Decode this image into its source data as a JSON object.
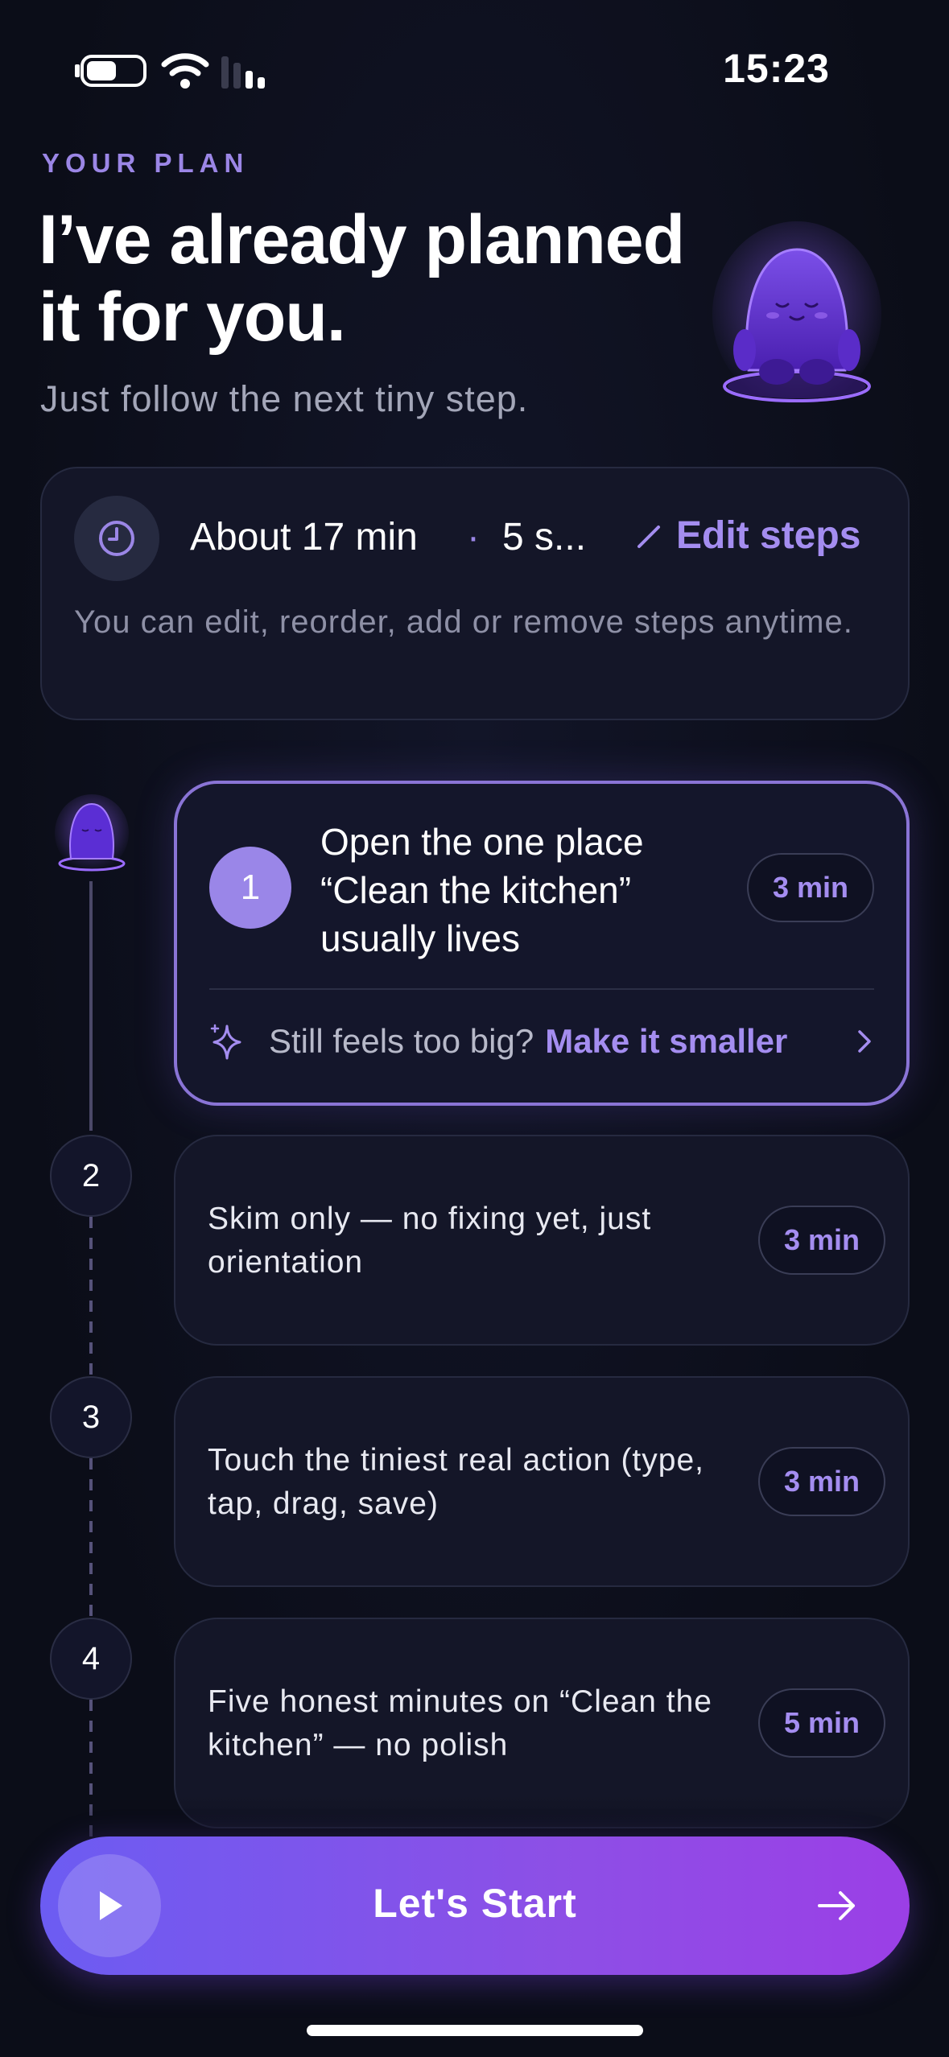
{
  "status_bar": {
    "time": "15:23"
  },
  "header": {
    "eyebrow": "YOUR PLAN",
    "title": "I’ve already planned it for you.",
    "subtitle": "Just follow the next tiny step."
  },
  "summary": {
    "duration": "About 17 min",
    "separator": "·",
    "steps": "5 s...",
    "edit_label": "Edit steps",
    "note": "You can edit, reorder, add or remove steps anytime."
  },
  "steps": [
    {
      "number": "1",
      "text": "Open the one place “Clean the kitchen” usually lives",
      "duration": "3 min"
    },
    {
      "number": "2",
      "text": "Skim only — no fixing yet, just orientation",
      "duration": "3 min"
    },
    {
      "number": "3",
      "text": "Touch the tiniest real action (type, tap, drag, save)",
      "duration": "3 min"
    },
    {
      "number": "4",
      "text": "Five honest minutes on “Clean the kitchen” — no polish",
      "duration": "5 min"
    }
  ],
  "make_smaller": {
    "question": "Still feels too big?",
    "link": "Make it smaller"
  },
  "cta": {
    "label": "Let's Start"
  },
  "icons": {
    "battery": "battery-icon",
    "wifi": "wifi-icon",
    "signal": "signal-icon",
    "clock": "clock-icon",
    "pencil": "pencil-icon",
    "sparkle": "sparkle-icon",
    "chevron": "chevron-right-icon",
    "play": "play-icon",
    "arrow": "arrow-right-icon",
    "mascot": "mascot-icon"
  },
  "colors": {
    "accent": "#a48df0",
    "background": "#0b0d18",
    "card": "#141628",
    "cta_start": "#6c5cf2",
    "cta_end": "#9b3fe6"
  }
}
